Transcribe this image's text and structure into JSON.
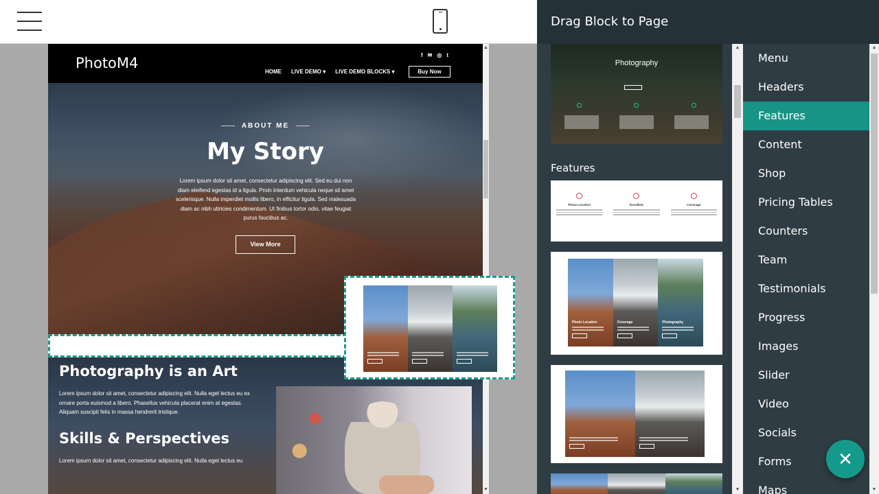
{
  "colors": {
    "accent": "#179485",
    "panel": "#2f3c44",
    "header": "#253138"
  },
  "panel": {
    "title": "Drag Block to Page"
  },
  "preview": {
    "brand": "PhotoM4",
    "nav": [
      "HOME",
      "LIVE DEMO ▾",
      "LIVE DEMO BLOCKS ▾"
    ],
    "buy_now": "Buy Now",
    "socials": [
      "f",
      "✉",
      "◎",
      "t"
    ],
    "hero": {
      "eyebrow": "ABOUT ME",
      "title": "My Story",
      "text": "Lorem ipsum dolor sit amet, consectetur adipiscing elit. Sed eu dui non diam eleifend egestas id a ligula. Proin interdum vehicula neque sit amet scelerisque. Nulla imperdiet mollis libero, in efficitur ligula. Sed malesuada diam ac nibh ultricies condimentum. Ut finibus tortor odio, vitae feugiat purus faucibus ac.",
      "button": "View More"
    },
    "section2": {
      "heading1": "Photography is an Art",
      "text1": "Lorem ipsum dolor sit amet, consectetur adipiscing elit. Nulla eget lectus eu ex ornare porta euismod a libero. Phasellus vehicula placerat enim at egestas. Aliquam suscipit felis in massa hendrerit tristique.",
      "heading2": "Skills & Perspectives",
      "text2": "Lorem ipsum dolor sit amet, consectetur adipiscing elit. Nulla eget lectus eu"
    }
  },
  "blocks": {
    "top_card_title": "Photography",
    "category_label": "Features",
    "feature_titles": [
      "Photo Location",
      "Excellent",
      "Coverage"
    ],
    "mountain_titles": [
      "Photo Location",
      "Coverage",
      "Photography"
    ]
  },
  "categories": [
    "Menu",
    "Headers",
    "Features",
    "Content",
    "Shop",
    "Pricing Tables",
    "Counters",
    "Team",
    "Testimonials",
    "Progress",
    "Images",
    "Slider",
    "Video",
    "Socials",
    "Forms",
    "Maps"
  ],
  "active_category": "Features",
  "fab": {
    "icon": "✕"
  }
}
